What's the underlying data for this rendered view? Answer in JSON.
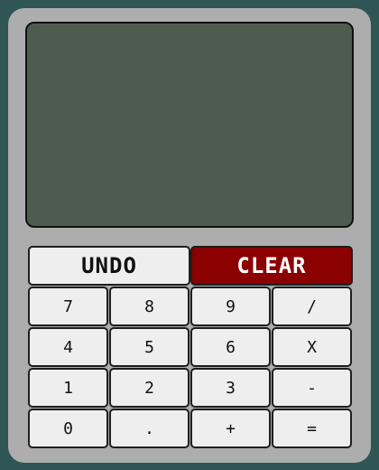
{
  "calculator": {
    "display_value": "",
    "actions": {
      "undo": "UNDO",
      "clear": "CLEAR"
    },
    "keys": {
      "k7": "7",
      "k8": "8",
      "k9": "9",
      "divide": "/",
      "k4": "4",
      "k5": "5",
      "k6": "6",
      "multiply": "X",
      "k1": "1",
      "k2": "2",
      "k3": "3",
      "minus": "-",
      "k0": "0",
      "dot": ".",
      "plus": "+",
      "equals": "="
    }
  },
  "colors": {
    "background": "#2f5654",
    "body": "#adadad",
    "display": "#4d5c4f",
    "button": "#eeeeee",
    "clear_button": "#8b0000"
  }
}
